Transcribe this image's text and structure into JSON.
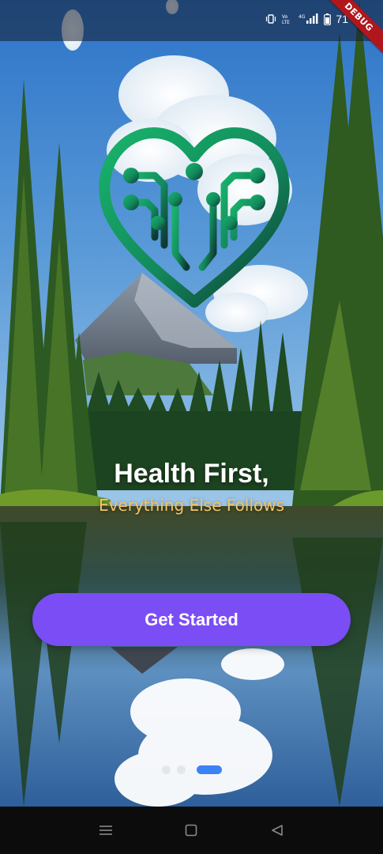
{
  "app": {
    "headline": "Health First,",
    "tagline": "Everything Else Follows",
    "cta_label": "Get Started",
    "logo_icon": "heart-circuit-icon"
  },
  "status_bar": {
    "battery_percent": "71",
    "debug_label": "DEBUG",
    "icons": [
      "vibrate-icon",
      "volte-icon",
      "signal-4g-icon",
      "battery-icon"
    ]
  },
  "onboarding": {
    "page_count": 3,
    "active_page": 3
  },
  "nav_bar": {
    "icons": [
      "menu-icon",
      "home-icon",
      "back-icon"
    ]
  },
  "colors": {
    "button": "#7b4df5",
    "tagline": "#f3c46a",
    "active_dot": "#3b82f6",
    "logo_gradient_start": "#19b36b",
    "logo_gradient_end": "#0e3a33"
  }
}
